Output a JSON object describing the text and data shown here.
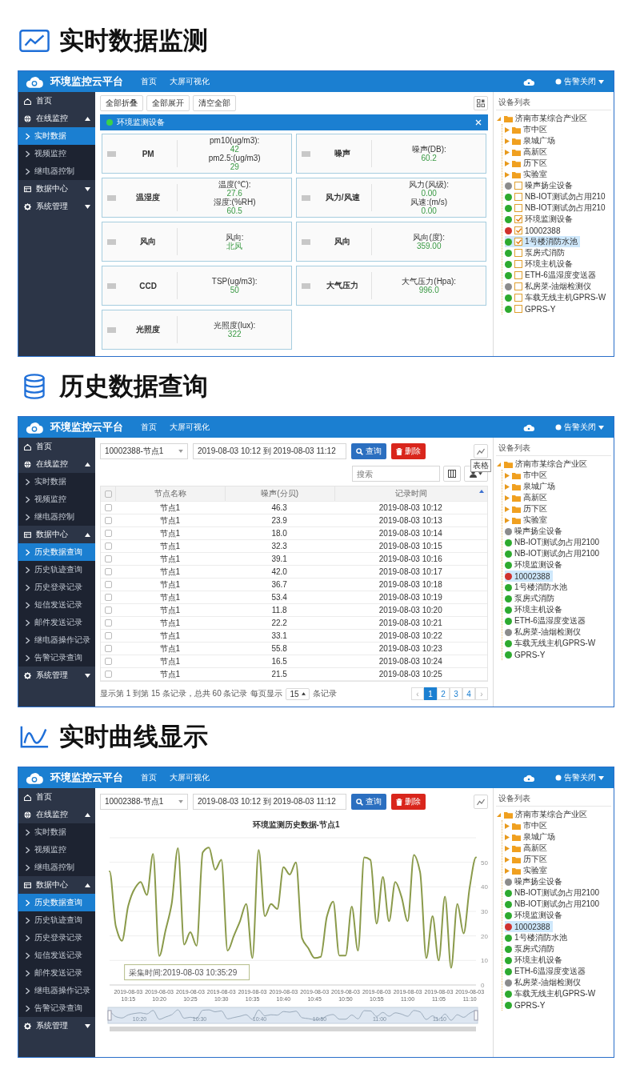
{
  "sections": [
    {
      "heading": "实时数据监测",
      "app": {
        "header": {
          "title": "环境监控云平台",
          "nav": [
            "首页",
            "大屏可视化"
          ],
          "alarm": "告警关闭"
        },
        "sidebar": {
          "items": [
            {
              "label": "首页",
              "kind": "link",
              "selected": false
            },
            {
              "label": "在线监控",
              "kind": "group",
              "selected": false,
              "expanded": true,
              "children": [
                {
                  "label": "实时数据",
                  "selected": true
                },
                {
                  "label": "视频监控",
                  "selected": false
                },
                {
                  "label": "继电器控制",
                  "selected": false
                }
              ]
            },
            {
              "label": "数据中心",
              "kind": "group",
              "selected": false,
              "expanded": false
            },
            {
              "label": "系统管理",
              "kind": "group",
              "selected": false,
              "expanded": false
            }
          ]
        },
        "tree": {
          "title": "设备列表",
          "root": {
            "label": "济南市某综合产业区",
            "kind": "folder",
            "expanded": true,
            "selected": false,
            "children": [
              {
                "label": "市中区",
                "kind": "folder",
                "expanded": false,
                "selected": false
              },
              {
                "label": "泉城广场",
                "kind": "folder",
                "expanded": false,
                "selected": false
              },
              {
                "label": "高新区",
                "kind": "folder",
                "expanded": false,
                "selected": false
              },
              {
                "label": "历下区",
                "kind": "folder",
                "expanded": false,
                "selected": false
              },
              {
                "label": "实验室",
                "kind": "folder",
                "expanded": false,
                "selected": false
              },
              {
                "label": "噪声扬尘设备",
                "kind": "device",
                "color": "#8c8c8c",
                "checked": false,
                "selected": false
              },
              {
                "label": "NB-IOT测试勿占用210",
                "kind": "device",
                "color": "#2eaa2e",
                "checked": false,
                "selected": false
              },
              {
                "label": "NB-IOT测试勿占用210",
                "kind": "device",
                "color": "#2eaa2e",
                "checked": false,
                "selected": false
              },
              {
                "label": "环境监测设备",
                "kind": "device",
                "color": "#2eaa2e",
                "checked": true,
                "selected": false
              },
              {
                "label": "10002388",
                "kind": "device",
                "color": "#d0312d",
                "checked": true,
                "selected": false
              },
              {
                "label": "1号楼消防水池",
                "kind": "device",
                "color": "#2eaa2e",
                "checked": true,
                "selected": true
              },
              {
                "label": "泵房式消防",
                "kind": "device",
                "color": "#2eaa2e",
                "checked": false,
                "selected": false
              },
              {
                "label": "环境主机设备",
                "kind": "device",
                "color": "#2eaa2e",
                "checked": false,
                "selected": false
              },
              {
                "label": "ETH-6温湿度变送器",
                "kind": "device",
                "color": "#2eaa2e",
                "checked": false,
                "selected": false
              },
              {
                "label": "私房菜-油烟检测仪",
                "kind": "device",
                "color": "#8c8c8c",
                "checked": false,
                "selected": false
              },
              {
                "label": "车载无线主机GPRS-W",
                "kind": "device",
                "color": "#2eaa2e",
                "checked": false,
                "selected": false
              },
              {
                "label": "GPRS-Y",
                "kind": "device",
                "color": "#2eaa2e",
                "checked": false,
                "selected": false
              }
            ]
          }
        },
        "content": {
          "kind": "realtime",
          "toolbar": [
            "全部折叠",
            "全部展开",
            "清空全部"
          ],
          "device": "环境监测设备",
          "cards": [
            {
              "name": "PM",
              "readings": [
                {
                  "label": "pm10(ug/m3):",
                  "value": "42"
                },
                {
                  "label": "pm2.5:(ug/m3)",
                  "value": "29"
                }
              ]
            },
            {
              "name": "噪声",
              "readings": [
                {
                  "label": "噪声(DB):",
                  "value": "60.2"
                }
              ]
            },
            {
              "name": "温湿度",
              "readings": [
                {
                  "label": "温度(℃):",
                  "value": "27.6"
                },
                {
                  "label": "湿度:(%RH)",
                  "value": "60.5"
                }
              ]
            },
            {
              "name": "风力/风速",
              "readings": [
                {
                  "label": "风力(风级):",
                  "value": "0.00"
                },
                {
                  "label": "风速:(m/s)",
                  "value": "0.00"
                }
              ]
            },
            {
              "name": "风向",
              "readings": [
                {
                  "label": "风向:",
                  "value": "北风"
                }
              ]
            },
            {
              "name": "风向",
              "readings": [
                {
                  "label": "风向(度):",
                  "value": "359.00"
                }
              ]
            },
            {
              "name": "CCD",
              "readings": [
                {
                  "label": "TSP(ug/m3):",
                  "value": "50"
                }
              ]
            },
            {
              "name": "大气压力",
              "readings": [
                {
                  "label": "大气压力(Hpa):",
                  "value": "996.0"
                }
              ]
            },
            {
              "name": "光照度",
              "readings": [
                {
                  "label": "光照度(lux):",
                  "value": "322"
                }
              ]
            }
          ]
        }
      }
    },
    {
      "heading": "历史数据查询",
      "app": {
        "header": {
          "title": "环境监控云平台",
          "nav": [
            "首页",
            "大屏可视化"
          ],
          "alarm": "告警关闭"
        },
        "sidebar": {
          "items": [
            {
              "label": "首页",
              "kind": "link",
              "selected": false
            },
            {
              "label": "在线监控",
              "kind": "group",
              "selected": false,
              "expanded": true,
              "children": [
                {
                  "label": "实时数据",
                  "selected": false
                },
                {
                  "label": "视频监控",
                  "selected": false
                },
                {
                  "label": "继电器控制",
                  "selected": false
                }
              ]
            },
            {
              "label": "数据中心",
              "kind": "group",
              "selected": false,
              "expanded": true,
              "children": [
                {
                  "label": "历史数据查询",
                  "selected": true
                },
                {
                  "label": "历史轨迹查询",
                  "selected": false
                },
                {
                  "label": "历史登录记录",
                  "selected": false
                },
                {
                  "label": "短信发送记录",
                  "selected": false
                },
                {
                  "label": "邮件发送记录",
                  "selected": false
                },
                {
                  "label": "继电器操作记录",
                  "selected": false
                },
                {
                  "label": "告警记录查询",
                  "selected": false
                }
              ]
            },
            {
              "label": "系统管理",
              "kind": "group",
              "selected": false,
              "expanded": false
            }
          ]
        },
        "tree": {
          "title": "设备列表",
          "root": {
            "label": "济南市某综合产业区",
            "kind": "folder",
            "expanded": true,
            "selected": false,
            "children": [
              {
                "label": "市中区",
                "kind": "folder",
                "expanded": false,
                "selected": false
              },
              {
                "label": "泉城广场",
                "kind": "folder",
                "expanded": false,
                "selected": false
              },
              {
                "label": "高新区",
                "kind": "folder",
                "expanded": false,
                "selected": false
              },
              {
                "label": "历下区",
                "kind": "folder",
                "expanded": false,
                "selected": false
              },
              {
                "label": "实验室",
                "kind": "folder",
                "expanded": false,
                "selected": false
              },
              {
                "label": "噪声扬尘设备",
                "kind": "device",
                "color": "#8c8c8c",
                "selected": false
              },
              {
                "label": "NB-IOT测试勿占用2100",
                "kind": "device",
                "color": "#2eaa2e",
                "selected": false
              },
              {
                "label": "NB-IOT测试勿占用2100",
                "kind": "device",
                "color": "#2eaa2e",
                "selected": false
              },
              {
                "label": "环境监测设备",
                "kind": "device",
                "color": "#2eaa2e",
                "selected": false
              },
              {
                "label": "10002388",
                "kind": "device",
                "color": "#d0312d",
                "selected": true
              },
              {
                "label": "1号楼消防水池",
                "kind": "device",
                "color": "#2eaa2e",
                "selected": false
              },
              {
                "label": "泵房式消防",
                "kind": "device",
                "color": "#2eaa2e",
                "selected": false
              },
              {
                "label": "环境主机设备",
                "kind": "device",
                "color": "#2eaa2e",
                "selected": false
              },
              {
                "label": "ETH-6温湿度变送器",
                "kind": "device",
                "color": "#2eaa2e",
                "selected": false
              },
              {
                "label": "私房菜-油烟检测仪",
                "kind": "device",
                "color": "#8c8c8c",
                "selected": false
              },
              {
                "label": "车载无线主机GPRS-W",
                "kind": "device",
                "color": "#2eaa2e",
                "selected": false
              },
              {
                "label": "GPRS-Y",
                "kind": "device",
                "color": "#2eaa2e",
                "selected": false
              }
            ]
          }
        },
        "content": {
          "kind": "history_table",
          "query": {
            "node_select": "10002388-节点1",
            "date_range": "2019-08-03 10:12 到 2019-08-03 11:12",
            "buttons": [
              {
                "label": "查询",
                "kind": "search"
              },
              {
                "label": "删除",
                "kind": "delete"
              }
            ]
          },
          "toggle_tooltip": "表格",
          "search": {
            "placeholder": "搜索"
          },
          "table": {
            "columns": [
              "节点名称",
              "噪声(分贝)",
              "记录时间"
            ],
            "header_checked": false,
            "rows": [
              {
                "checked": false,
                "cells": [
                  "节点1",
                  "46.3",
                  "2019-08-03 10:12"
                ]
              },
              {
                "checked": false,
                "cells": [
                  "节点1",
                  "23.9",
                  "2019-08-03 10:13"
                ]
              },
              {
                "checked": false,
                "cells": [
                  "节点1",
                  "18.0",
                  "2019-08-03 10:14"
                ]
              },
              {
                "checked": false,
                "cells": [
                  "节点1",
                  "32.3",
                  "2019-08-03 10:15"
                ]
              },
              {
                "checked": false,
                "cells": [
                  "节点1",
                  "39.1",
                  "2019-08-03 10:16"
                ]
              },
              {
                "checked": false,
                "cells": [
                  "节点1",
                  "42.0",
                  "2019-08-03 10:17"
                ]
              },
              {
                "checked": false,
                "cells": [
                  "节点1",
                  "36.7",
                  "2019-08-03 10:18"
                ]
              },
              {
                "checked": false,
                "cells": [
                  "节点1",
                  "53.4",
                  "2019-08-03 10:19"
                ]
              },
              {
                "checked": false,
                "cells": [
                  "节点1",
                  "11.8",
                  "2019-08-03 10:20"
                ]
              },
              {
                "checked": false,
                "cells": [
                  "节点1",
                  "22.2",
                  "2019-08-03 10:21"
                ]
              },
              {
                "checked": false,
                "cells": [
                  "节点1",
                  "33.1",
                  "2019-08-03 10:22"
                ]
              },
              {
                "checked": false,
                "cells": [
                  "节点1",
                  "55.8",
                  "2019-08-03 10:23"
                ]
              },
              {
                "checked": false,
                "cells": [
                  "节点1",
                  "16.5",
                  "2019-08-03 10:24"
                ]
              },
              {
                "checked": false,
                "cells": [
                  "节点1",
                  "21.5",
                  "2019-08-03 10:25"
                ]
              }
            ]
          },
          "pagination": {
            "summary": "显示第 1 到第 15 条记录，总共 60 条记录",
            "per_page_label": "每页显示",
            "per_page": "15",
            "per_page_suffix": "条记录",
            "prev": "‹",
            "next": "›",
            "pages": [
              {
                "label": "1",
                "selected": true
              },
              {
                "label": "2",
                "selected": false
              },
              {
                "label": "3",
                "selected": false
              },
              {
                "label": "4",
                "selected": false
              }
            ]
          }
        }
      }
    },
    {
      "heading": "实时曲线显示",
      "app": {
        "header": {
          "title": "环境监控云平台",
          "nav": [
            "首页",
            "大屏可视化"
          ],
          "alarm": "告警关闭"
        },
        "sidebar": {
          "items": [
            {
              "label": "首页",
              "kind": "link",
              "selected": false
            },
            {
              "label": "在线监控",
              "kind": "group",
              "selected": false,
              "expanded": true,
              "children": [
                {
                  "label": "实时数据",
                  "selected": false
                },
                {
                  "label": "视频监控",
                  "selected": false
                },
                {
                  "label": "继电器控制",
                  "selected": false
                }
              ]
            },
            {
              "label": "数据中心",
              "kind": "group",
              "selected": false,
              "expanded": true,
              "children": [
                {
                  "label": "历史数据查询",
                  "selected": true
                },
                {
                  "label": "历史轨迹查询",
                  "selected": false
                },
                {
                  "label": "历史登录记录",
                  "selected": false
                },
                {
                  "label": "短信发送记录",
                  "selected": false
                },
                {
                  "label": "邮件发送记录",
                  "selected": false
                },
                {
                  "label": "继电器操作记录",
                  "selected": false
                },
                {
                  "label": "告警记录查询",
                  "selected": false
                }
              ]
            },
            {
              "label": "系统管理",
              "kind": "group",
              "selected": false,
              "expanded": false
            }
          ]
        },
        "tree": {
          "title": "设备列表",
          "root": {
            "label": "济南市某综合产业区",
            "kind": "folder",
            "expanded": true,
            "selected": false,
            "children": [
              {
                "label": "市中区",
                "kind": "folder",
                "expanded": false,
                "selected": false
              },
              {
                "label": "泉城广场",
                "kind": "folder",
                "expanded": false,
                "selected": false
              },
              {
                "label": "高新区",
                "kind": "folder",
                "expanded": false,
                "selected": false
              },
              {
                "label": "历下区",
                "kind": "folder",
                "expanded": false,
                "selected": false
              },
              {
                "label": "实验室",
                "kind": "folder",
                "expanded": false,
                "selected": false
              },
              {
                "label": "噪声扬尘设备",
                "kind": "device",
                "color": "#8c8c8c",
                "selected": false
              },
              {
                "label": "NB-IOT测试勿占用2100",
                "kind": "device",
                "color": "#2eaa2e",
                "selected": false
              },
              {
                "label": "NB-IOT测试勿占用2100",
                "kind": "device",
                "color": "#2eaa2e",
                "selected": false
              },
              {
                "label": "环境监测设备",
                "kind": "device",
                "color": "#2eaa2e",
                "selected": false
              },
              {
                "label": "10002388",
                "kind": "device",
                "color": "#d0312d",
                "selected": true
              },
              {
                "label": "1号楼消防水池",
                "kind": "device",
                "color": "#2eaa2e",
                "selected": false
              },
              {
                "label": "泵房式消防",
                "kind": "device",
                "color": "#2eaa2e",
                "selected": false
              },
              {
                "label": "环境主机设备",
                "kind": "device",
                "color": "#2eaa2e",
                "selected": false
              },
              {
                "label": "ETH-6温湿度变送器",
                "kind": "device",
                "color": "#2eaa2e",
                "selected": false
              },
              {
                "label": "私房菜-油烟检测仪",
                "kind": "device",
                "color": "#8c8c8c",
                "selected": false
              },
              {
                "label": "车载无线主机GPRS-W",
                "kind": "device",
                "color": "#2eaa2e",
                "selected": false
              },
              {
                "label": "GPRS-Y",
                "kind": "device",
                "color": "#2eaa2e",
                "selected": false
              }
            ]
          }
        },
        "content": {
          "kind": "history_chart",
          "query": {
            "node_select": "10002388-节点1",
            "date_range": "2019-08-03 10:12 到 2019-08-03 11:12",
            "buttons": [
              {
                "label": "查询",
                "kind": "search"
              },
              {
                "label": "删除",
                "kind": "delete"
              }
            ]
          },
          "chart_data": {
            "type": "line",
            "title": "环境监测历史数据-节点1",
            "categories": [
              null,
              null,
              null,
              "2019-08-03 10:15",
              null,
              null,
              null,
              null,
              "2019-08-03 10:20",
              null,
              null,
              null,
              null,
              "2019-08-03 10:25",
              null,
              null,
              null,
              null,
              "2019-08-03 10:30",
              null,
              null,
              null,
              null,
              "2019-08-03 10:35",
              null,
              null,
              null,
              null,
              "2019-08-03 10:40",
              null,
              null,
              null,
              null,
              "2019-08-03 10:45",
              null,
              null,
              null,
              null,
              "2019-08-03 10:50",
              null,
              null,
              null,
              null,
              "2019-08-03 10:55",
              null,
              null,
              null,
              null,
              "2019-08-03 11:00",
              null,
              null,
              null,
              null,
              "2019-08-03 11:05",
              null,
              null,
              null,
              null,
              "2019-08-03 11:10",
              null
            ],
            "values": [
              46.3,
              23.9,
              18.0,
              32.3,
              39.1,
              42.0,
              36.7,
              53.4,
              11.8,
              22.2,
              33.1,
              55.8,
              16.5,
              21.5,
              16.0,
              54.0,
              56.0,
              47.0,
              51.0,
              14.0,
              20.0,
              26.0,
              33.0,
              11.0,
              55.0,
              28.0,
              33.0,
              31.0,
              48.0,
              45.0,
              50.0,
              19.0,
              15.0,
              11.0,
              11.5,
              28.0,
              34.0,
              12.0,
              12.0,
              32.0,
              14.0,
              52.0,
              51.0,
              25.0,
              44.0,
              26.0,
              42.0,
              36.0,
              26.0,
              53.0,
              46.0,
              11.0,
              28.0,
              10.0,
              36.0,
              7.0,
              33.0,
              21.0,
              40.0,
              52.0
            ],
            "ylim": [
              0,
              60
            ],
            "yticks": [
              0,
              10,
              20,
              30,
              40,
              50
            ],
            "grid": true,
            "annotations": [
              "采集时间:2019-08-03 10:35:29"
            ]
          },
          "zoom_labels": [
            "10:20",
            "10:30",
            "10:40",
            "10:50",
            "11:00",
            "11:10"
          ]
        }
      }
    }
  ]
}
